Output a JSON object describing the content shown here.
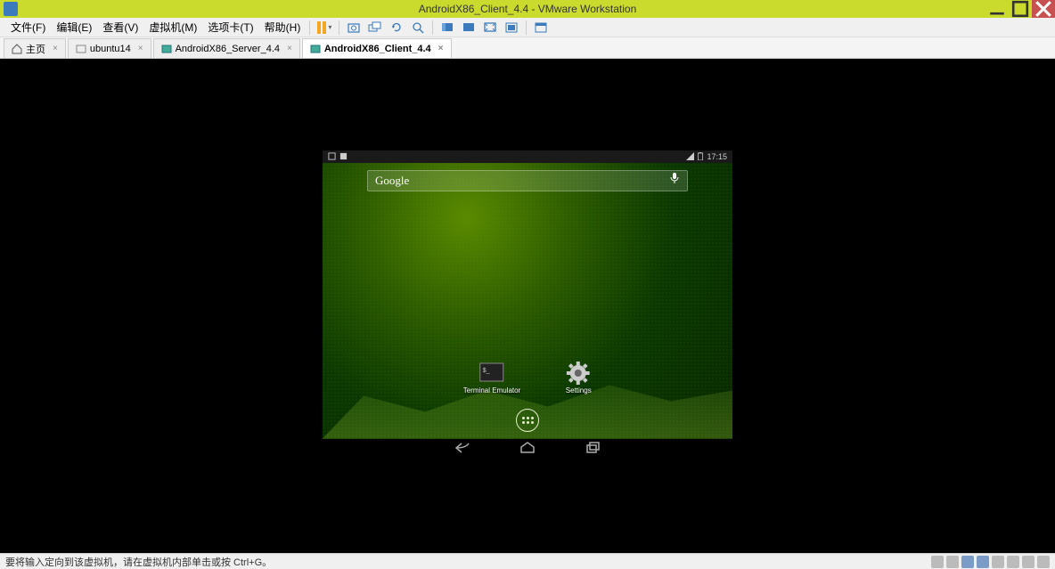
{
  "window": {
    "title": "AndroidX86_Client_4.4 - VMware Workstation"
  },
  "menu": {
    "file": "文件(F)",
    "edit": "编辑(E)",
    "view": "查看(V)",
    "vm": "虚拟机(M)",
    "tabs": "选项卡(T)",
    "help": "帮助(H)"
  },
  "tabs": {
    "home": "主页",
    "items": [
      {
        "label": "ubuntu14"
      },
      {
        "label": "AndroidX86_Server_4.4"
      },
      {
        "label": "AndroidX86_Client_4.4"
      }
    ]
  },
  "android": {
    "time": "17:15",
    "search_brand": "Google",
    "icons": {
      "terminal": "Terminal Emulator",
      "settings": "Settings"
    }
  },
  "status": {
    "hint": "要将输入定向到该虚拟机，请在虚拟机内部单击或按 Ctrl+G。"
  }
}
